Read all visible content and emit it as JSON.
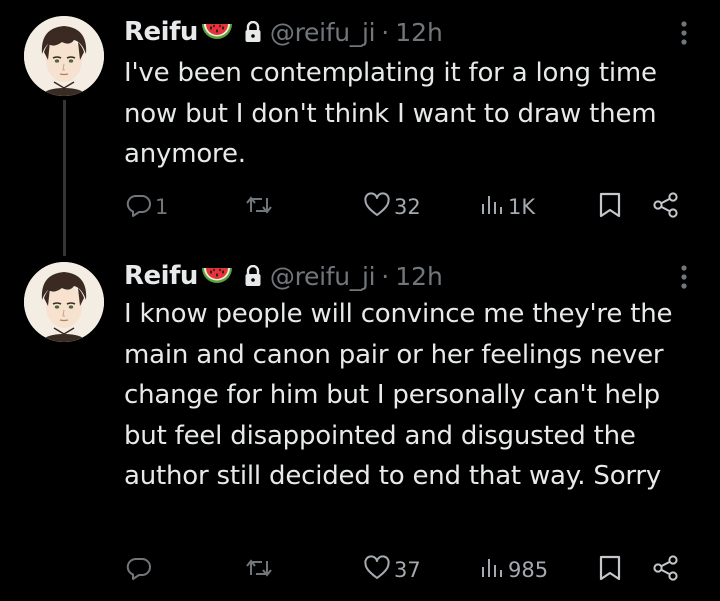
{
  "tweets": [
    {
      "name": "Reifu",
      "handle": "@reifu_ji",
      "separator": "·",
      "time": "12h",
      "text": "I've been contemplating it for a long time now but I don't think I want to draw them anymore.",
      "replies": "1",
      "retweets": "",
      "likes": "32",
      "views": "1K"
    },
    {
      "name": "Reifu",
      "handle": "@reifu_ji",
      "separator": "·",
      "time": "12h",
      "text": "I know people will convince me they're the main and canon pair or her feelings never change for him but I personally can't help but feel disappointed and disgusted the author still decided to end that way. Sorry",
      "replies": "",
      "retweets": "",
      "likes": "37",
      "views": "985"
    }
  ],
  "icons": {
    "name_emoji": "watermelon-icon",
    "protected": "lock-icon",
    "more": "more-icon",
    "reply": "reply-icon",
    "retweet": "retweet-icon",
    "like": "heart-icon",
    "views": "views-icon",
    "bookmark": "bookmark-icon",
    "share": "share-icon"
  },
  "colors": {
    "background": "#000000",
    "text_primary": "#e7e9ea",
    "text_secondary": "#71767b",
    "thread_line": "#333639"
  }
}
